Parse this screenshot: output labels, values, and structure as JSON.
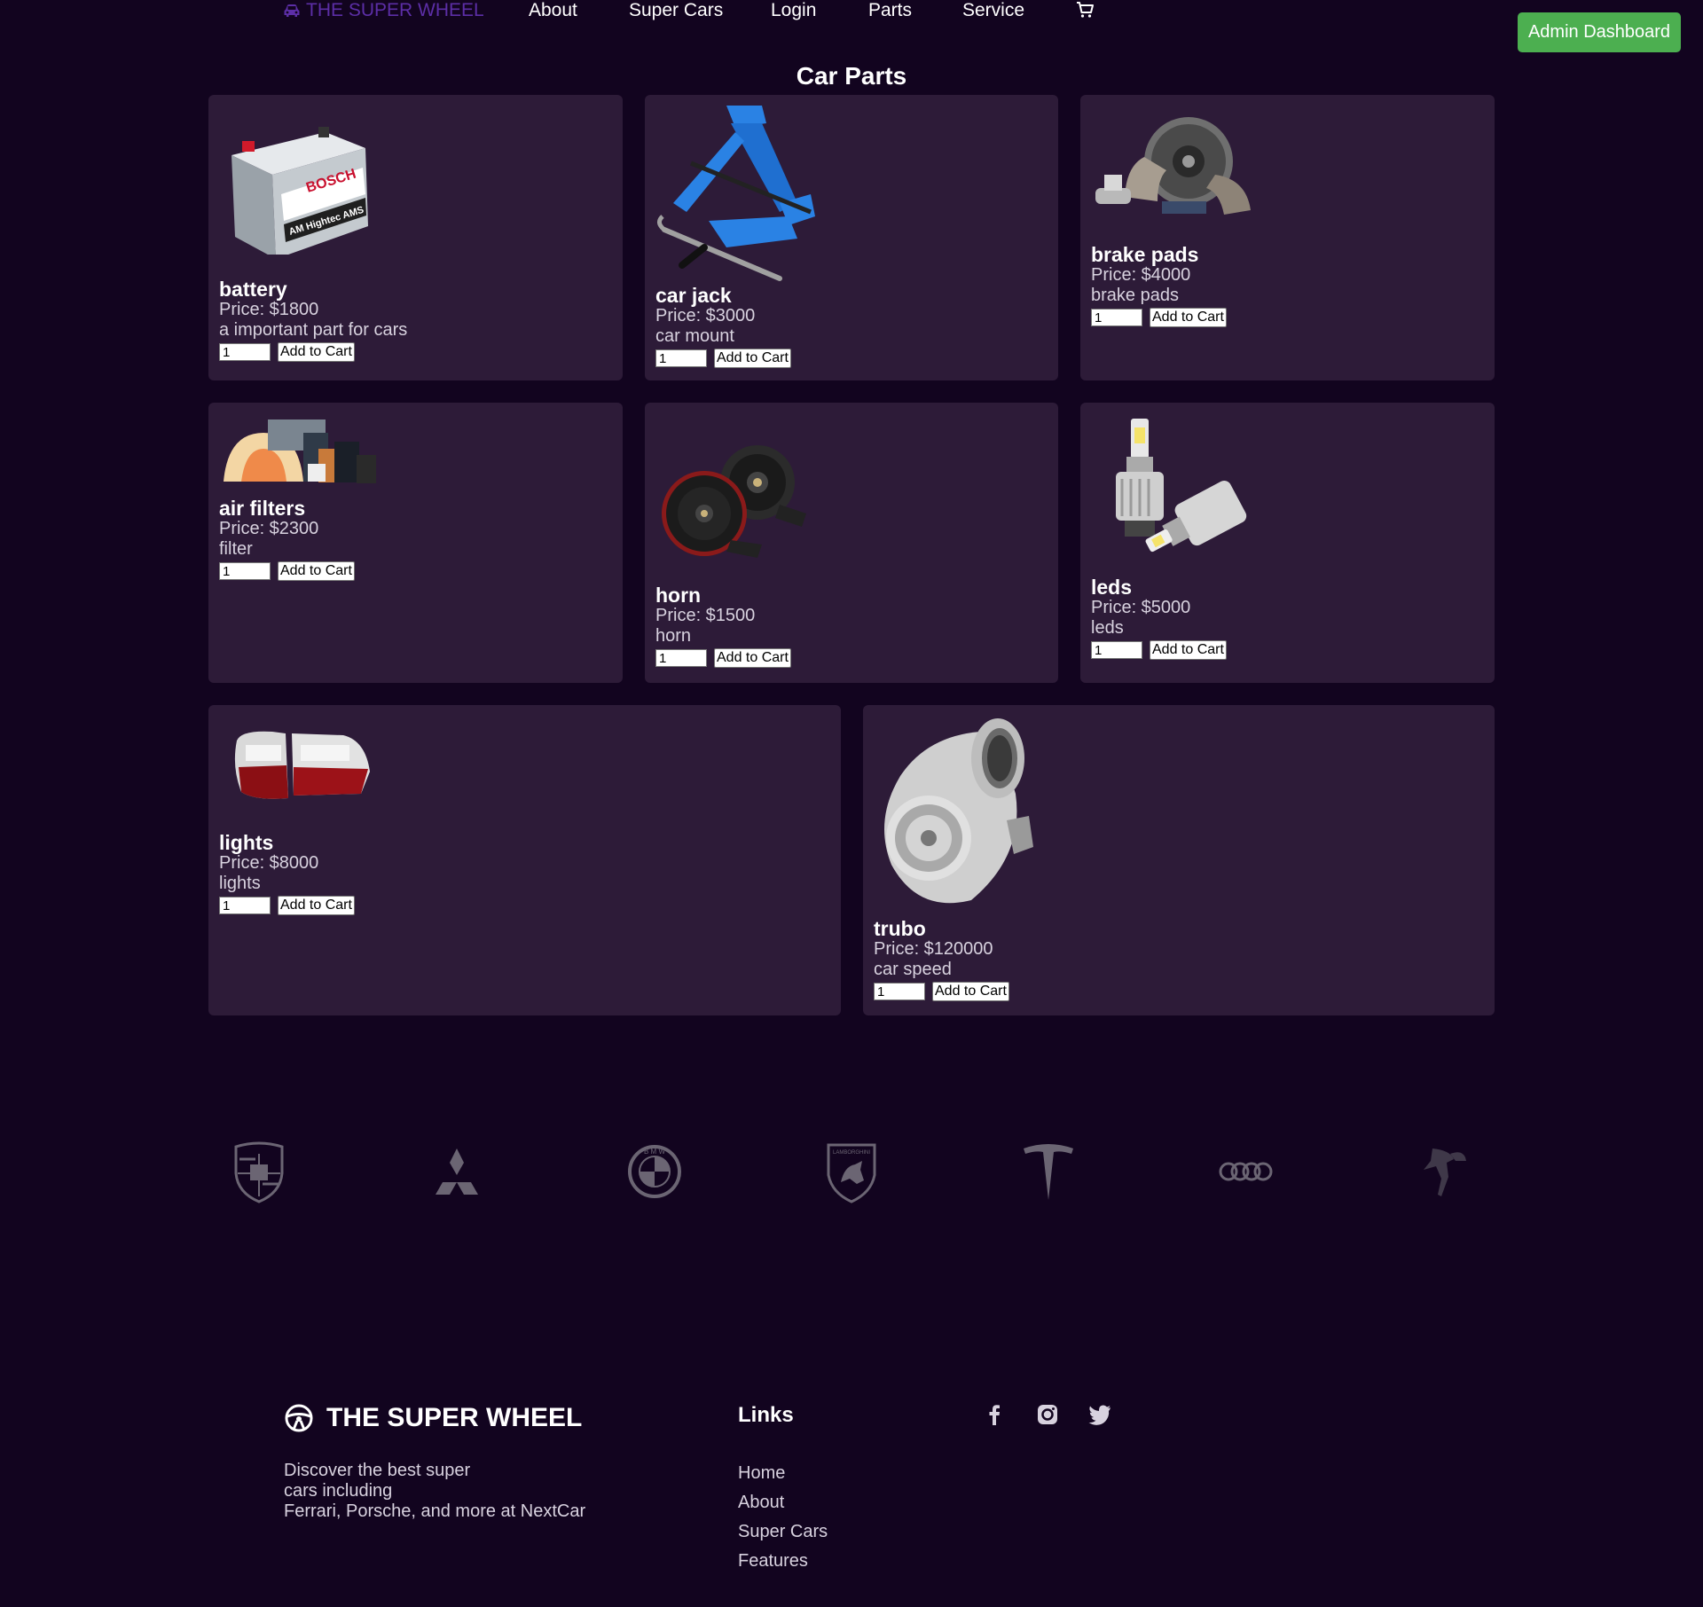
{
  "nav": {
    "brand": "THE SUPER WHEEL",
    "links": [
      "About",
      "Super Cars",
      "Login",
      "Parts",
      "Service"
    ],
    "admin_button": "Admin Dashboard"
  },
  "page_title": "Car Parts",
  "products": [
    {
      "name": "battery",
      "price": "Price: $1800",
      "description": "a important part for cars",
      "qty": "1",
      "button": "Add to Cart"
    },
    {
      "name": "car jack",
      "price": "Price: $3000",
      "description": "car mount",
      "qty": "1",
      "button": "Add to Cart"
    },
    {
      "name": "brake pads",
      "price": "Price: $4000",
      "description": "brake pads",
      "qty": "1",
      "button": "Add to Cart"
    },
    {
      "name": "air filters",
      "price": "Price: $2300",
      "description": "filter",
      "qty": "1",
      "button": "Add to Cart"
    },
    {
      "name": "horn",
      "price": "Price: $1500",
      "description": "horn",
      "qty": "1",
      "button": "Add to Cart"
    },
    {
      "name": "leds",
      "price": "Price: $5000",
      "description": "leds",
      "qty": "1",
      "button": "Add to Cart"
    },
    {
      "name": "lights",
      "price": "Price: $8000",
      "description": "lights",
      "qty": "1",
      "button": "Add to Cart"
    },
    {
      "name": "trubo",
      "price": "Price: $120000",
      "description": "car speed",
      "qty": "1",
      "button": "Add to Cart"
    }
  ],
  "product_image_text": {
    "battery_brand": "BOSCH",
    "battery_label": "AM Hightec AMS"
  },
  "brand_logos": [
    "porsche-logo",
    "mitsubishi-logo",
    "bmw-logo",
    "lamborghini-logo",
    "tesla-logo",
    "audi-logo",
    "rolls-royce-logo"
  ],
  "brand_logo_text": {
    "bmw": "B M W",
    "lamborghini": "LAMBORGHINI"
  },
  "footer": {
    "brand": "THE SUPER WHEEL",
    "description_lines": [
      "Discover the best super",
      "cars including",
      "Ferrari, Porsche, and more at NextCar"
    ],
    "links_title": "Links",
    "links": [
      "Home",
      "About",
      "Super Cars",
      "Features"
    ],
    "social": [
      "facebook-icon",
      "instagram-icon",
      "twitter-icon"
    ]
  },
  "colors": {
    "background": "#12041f",
    "card": "#2d1b38",
    "brand": "#5c2ea6",
    "admin_button": "#4caf50",
    "logo_gray": "#6b6573"
  }
}
